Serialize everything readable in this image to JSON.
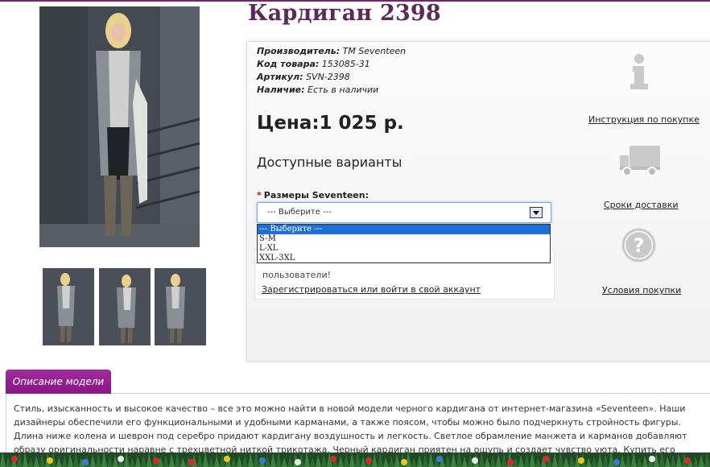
{
  "product": {
    "title": "Кардиган 2398",
    "specs": [
      {
        "label": "Производитель:",
        "value": "TM Seventeen"
      },
      {
        "label": "Код товара:",
        "value": "153085-31"
      },
      {
        "label": "Артикул:",
        "value": "SVN-2398"
      },
      {
        "label": "Наличие:",
        "value": "Есть в наличии"
      }
    ],
    "price": "Цена:1 025 р.",
    "variants_heading": "Доступные варианты"
  },
  "options": {
    "required_mark": "*",
    "label": "Размеры Seventeen:",
    "selected_value": "--- Выберите ---",
    "items": [
      "--- Выберите ---",
      "S-M",
      "L-XL",
      "XXL-3XL"
    ]
  },
  "notice": {
    "text": "пользователи!",
    "link": "Зарегистрироваться или войти в свой аккаунт"
  },
  "side_links": {
    "instruction": "Инструкция по покупке",
    "delivery": "Сроки доставки",
    "terms": "Условия покупки"
  },
  "icons": {
    "info": "info-icon",
    "truck": "truck-icon",
    "question": "question-icon"
  },
  "description": {
    "tab_label": "Описание модели",
    "text": "Стиль, изысканность и высокое качество – все это можно найти в новой модели черного кардигана от интернет-магазина «Seventeen». Наши дизайнеры обеспечили его функциональными и удобными карманами, а также поясом, чтобы можно было подчеркнуть стройность фигуры. Длина ниже колена и шеврон под серебро придают кардигану воздушность и легкость. Светлое обрамление манжета и карманов добавляют образу оригинальности наравне с трехцветной ниткой трикотажа. Черный кардиган приятен на ощупь и создает чувство уюта. Купить его можно недорого, заказав в розницу по доступной цене или выбрав"
  },
  "colors": {
    "accent": "#86177f",
    "title": "#5a2a5a",
    "select_highlight": "#1e6fd9"
  }
}
